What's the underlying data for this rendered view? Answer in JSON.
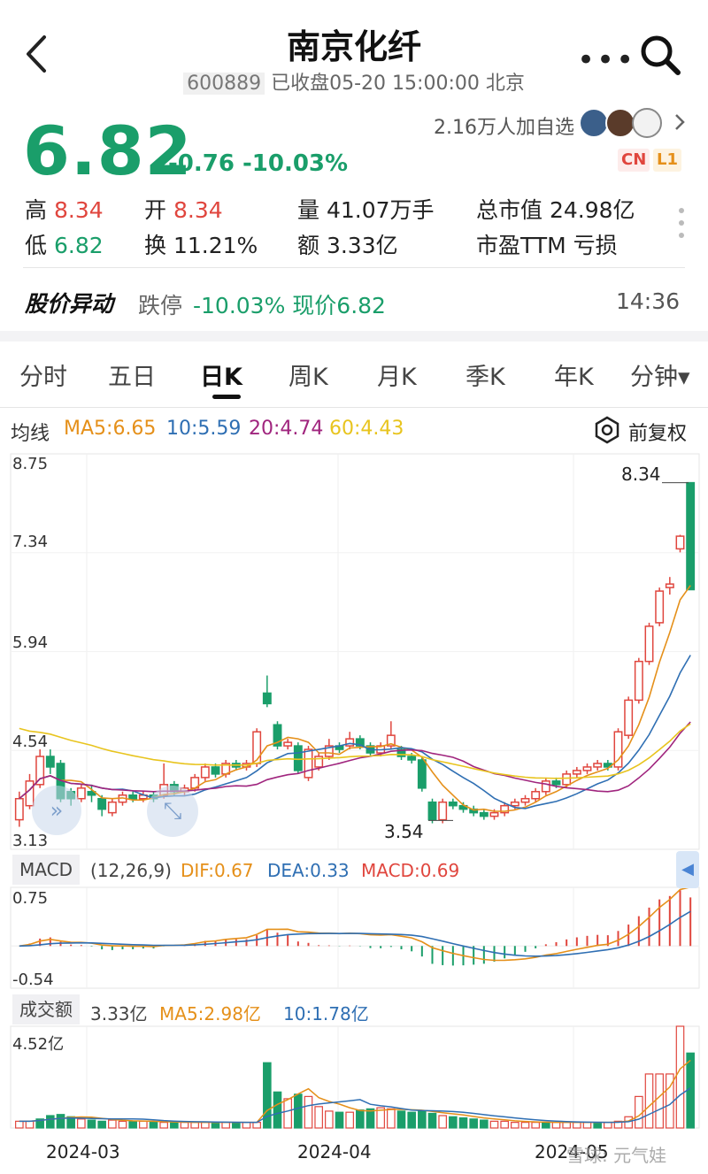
{
  "header": {
    "title": "南京化纤",
    "code": "600889",
    "status": "已收盘05-20 15:00:00 北京"
  },
  "quote": {
    "price": "6.82",
    "change": "-0.76 -10.03%",
    "watchers": "2.16万人加自选",
    "tag_cn": "CN",
    "tag_l1": "L1"
  },
  "stats": {
    "high_label": "高",
    "high": "8.34",
    "open_label": "开",
    "open": "8.34",
    "volume": "量 41.07万手",
    "mktcap": "总市值 24.98亿",
    "low_label": "低",
    "low": "6.82",
    "turnover_label": "换",
    "turnover": "11.21%",
    "amount": "额 3.33亿",
    "pe": "市盈TTM 亏损"
  },
  "alert": {
    "title": "股价异动",
    "type": "跌停",
    "text": "-10.03% 现价6.82",
    "time": "14:36"
  },
  "tabs": [
    "分时",
    "五日",
    "日K",
    "周K",
    "月K",
    "季K",
    "年K",
    "分钟▾"
  ],
  "active_tab": 2,
  "ma": {
    "label": "均线",
    "ma5": "MA5:6.65",
    "ma10": "10:5.59",
    "ma20": "20:4.74",
    "ma60": "60:4.43",
    "adjust": "前复权"
  },
  "colors": {
    "up": "#e0463e",
    "down": "#1a9e6a",
    "ma5": "#e5901a",
    "ma10": "#2f6fb3",
    "ma20": "#a0257e",
    "ma60": "#e8c41e"
  },
  "chart_data": {
    "type": "candlestick",
    "y_ticks": [
      "8.75",
      "7.34",
      "5.94",
      "4.54",
      "3.13"
    ],
    "ylim": [
      3.13,
      8.75
    ],
    "x_ticks": [
      "2024-03",
      "2024-04",
      "2024-05"
    ],
    "annotations": {
      "high": "8.34",
      "low": "3.54"
    },
    "candles": [
      {
        "o": 3.55,
        "c": 3.85,
        "h": 3.95,
        "l": 3.45
      },
      {
        "o": 3.75,
        "c": 4.1,
        "h": 4.2,
        "l": 3.7
      },
      {
        "o": 4.05,
        "c": 4.45,
        "h": 4.55,
        "l": 4.0
      },
      {
        "o": 4.45,
        "c": 4.3,
        "h": 4.55,
        "l": 4.2
      },
      {
        "o": 4.35,
        "c": 3.85,
        "h": 4.4,
        "l": 3.8
      },
      {
        "o": 3.95,
        "c": 3.85,
        "h": 4.0,
        "l": 3.75
      },
      {
        "o": 3.85,
        "c": 4.0,
        "h": 4.05,
        "l": 3.8
      },
      {
        "o": 3.95,
        "c": 3.9,
        "h": 4.05,
        "l": 3.8
      },
      {
        "o": 3.85,
        "c": 3.7,
        "h": 3.9,
        "l": 3.6
      },
      {
        "o": 3.65,
        "c": 3.8,
        "h": 3.85,
        "l": 3.6
      },
      {
        "o": 3.8,
        "c": 3.9,
        "h": 3.95,
        "l": 3.75
      },
      {
        "o": 3.9,
        "c": 3.85,
        "h": 3.95,
        "l": 3.8
      },
      {
        "o": 3.85,
        "c": 3.9,
        "h": 3.95,
        "l": 3.8
      },
      {
        "o": 3.9,
        "c": 3.85,
        "h": 3.95,
        "l": 3.8
      },
      {
        "o": 3.9,
        "c": 4.05,
        "h": 4.35,
        "l": 3.85
      },
      {
        "o": 4.05,
        "c": 3.95,
        "h": 4.1,
        "l": 3.9
      },
      {
        "o": 3.95,
        "c": 4.0,
        "h": 4.05,
        "l": 3.9
      },
      {
        "o": 4.0,
        "c": 4.15,
        "h": 4.2,
        "l": 3.95
      },
      {
        "o": 4.15,
        "c": 4.3,
        "h": 4.35,
        "l": 4.1
      },
      {
        "o": 4.3,
        "c": 4.2,
        "h": 4.35,
        "l": 4.15
      },
      {
        "o": 4.2,
        "c": 4.35,
        "h": 4.4,
        "l": 4.15
      },
      {
        "o": 4.35,
        "c": 4.3,
        "h": 4.4,
        "l": 4.25
      },
      {
        "o": 4.3,
        "c": 4.35,
        "h": 4.4,
        "l": 4.25
      },
      {
        "o": 4.35,
        "c": 4.8,
        "h": 4.85,
        "l": 4.3
      },
      {
        "o": 5.35,
        "c": 5.2,
        "h": 5.6,
        "l": 5.15
      },
      {
        "o": 4.9,
        "c": 4.6,
        "h": 4.95,
        "l": 4.55
      },
      {
        "o": 4.6,
        "c": 4.65,
        "h": 4.7,
        "l": 4.55
      },
      {
        "o": 4.6,
        "c": 4.25,
        "h": 4.65,
        "l": 4.2
      },
      {
        "o": 4.15,
        "c": 4.55,
        "h": 4.6,
        "l": 4.1
      },
      {
        "o": 4.3,
        "c": 4.45,
        "h": 4.5,
        "l": 4.25
      },
      {
        "o": 4.45,
        "c": 4.6,
        "h": 4.7,
        "l": 4.4
      },
      {
        "o": 4.6,
        "c": 4.55,
        "h": 4.65,
        "l": 4.5
      },
      {
        "o": 4.6,
        "c": 4.7,
        "h": 4.8,
        "l": 4.55
      },
      {
        "o": 4.7,
        "c": 4.6,
        "h": 4.75,
        "l": 4.55
      },
      {
        "o": 4.6,
        "c": 4.5,
        "h": 4.65,
        "l": 4.45
      },
      {
        "o": 4.5,
        "c": 4.6,
        "h": 4.65,
        "l": 4.45
      },
      {
        "o": 4.6,
        "c": 4.75,
        "h": 4.95,
        "l": 4.55
      },
      {
        "o": 4.55,
        "c": 4.45,
        "h": 4.6,
        "l": 4.4
      },
      {
        "o": 4.45,
        "c": 4.4,
        "h": 4.5,
        "l": 4.35
      },
      {
        "o": 4.4,
        "c": 4.0,
        "h": 4.45,
        "l": 3.95
      },
      {
        "o": 3.8,
        "c": 3.55,
        "h": 3.85,
        "l": 3.5
      },
      {
        "o": 3.55,
        "c": 3.8,
        "h": 3.85,
        "l": 3.5
      },
      {
        "o": 3.8,
        "c": 3.75,
        "h": 3.85,
        "l": 3.7
      },
      {
        "o": 3.75,
        "c": 3.7,
        "h": 3.8,
        "l": 3.65
      },
      {
        "o": 3.7,
        "c": 3.65,
        "h": 3.75,
        "l": 3.6
      },
      {
        "o": 3.65,
        "c": 3.6,
        "h": 3.7,
        "l": 3.55
      },
      {
        "o": 3.6,
        "c": 3.65,
        "h": 3.7,
        "l": 3.55
      },
      {
        "o": 3.65,
        "c": 3.75,
        "h": 3.8,
        "l": 3.6
      },
      {
        "o": 3.75,
        "c": 3.8,
        "h": 3.85,
        "l": 3.7
      },
      {
        "o": 3.8,
        "c": 3.85,
        "h": 3.9,
        "l": 3.75
      },
      {
        "o": 3.85,
        "c": 3.95,
        "h": 4.0,
        "l": 3.8
      },
      {
        "o": 3.95,
        "c": 4.1,
        "h": 4.15,
        "l": 3.9
      },
      {
        "o": 4.1,
        "c": 4.05,
        "h": 4.15,
        "l": 4.0
      },
      {
        "o": 4.05,
        "c": 4.2,
        "h": 4.25,
        "l": 4.0
      },
      {
        "o": 4.2,
        "c": 4.25,
        "h": 4.3,
        "l": 4.15
      },
      {
        "o": 4.25,
        "c": 4.3,
        "h": 4.35,
        "l": 4.2
      },
      {
        "o": 4.3,
        "c": 4.35,
        "h": 4.4,
        "l": 4.25
      },
      {
        "o": 4.35,
        "c": 4.3,
        "h": 4.4,
        "l": 4.25
      },
      {
        "o": 4.3,
        "c": 4.8,
        "h": 4.85,
        "l": 4.25
      },
      {
        "o": 4.75,
        "c": 5.25,
        "h": 5.3,
        "l": 4.7
      },
      {
        "o": 5.25,
        "c": 5.8,
        "h": 5.85,
        "l": 5.2
      },
      {
        "o": 5.8,
        "c": 6.3,
        "h": 6.35,
        "l": 5.75
      },
      {
        "o": 6.35,
        "c": 6.8,
        "h": 6.85,
        "l": 6.3
      },
      {
        "o": 6.85,
        "c": 6.9,
        "h": 7.0,
        "l": 6.75
      },
      {
        "o": 7.4,
        "c": 7.58,
        "h": 7.6,
        "l": 7.35
      },
      {
        "o": 8.34,
        "c": 6.82,
        "h": 8.34,
        "l": 6.82
      }
    ],
    "macd": {
      "label": "MACD",
      "params": "(12,26,9)",
      "dif": "DIF:0.67",
      "dea": "DEA:0.33",
      "macd": "MACD:0.69",
      "y_ticks": [
        "0.75",
        "-0.54"
      ],
      "ylim": [
        -0.54,
        0.75
      ]
    },
    "volume": {
      "label": "成交额",
      "amount": "3.33亿",
      "ma5": "MA5:2.98亿",
      "ma10": "10:1.78亿",
      "y_tick": "4.52亿",
      "ylim": [
        0,
        4.52
      ],
      "values": [
        0.3,
        0.3,
        0.4,
        0.55,
        0.6,
        0.5,
        0.4,
        0.35,
        0.3,
        0.35,
        0.3,
        0.3,
        0.3,
        0.25,
        0.25,
        0.25,
        0.25,
        0.25,
        0.25,
        0.25,
        0.25,
        0.25,
        0.25,
        0.25,
        2.9,
        1.6,
        1.3,
        1.5,
        1.4,
        0.95,
        0.75,
        0.7,
        0.7,
        0.8,
        0.85,
        0.9,
        0.85,
        0.75,
        0.7,
        0.75,
        0.65,
        0.55,
        0.5,
        0.45,
        0.4,
        0.35,
        0.3,
        0.3,
        0.25,
        0.25,
        0.25,
        0.25,
        0.25,
        0.25,
        0.25,
        0.25,
        0.25,
        0.25,
        0.3,
        0.5,
        1.4,
        2.4,
        2.4,
        2.4,
        4.52,
        3.33
      ],
      "ups": [
        1,
        1,
        0,
        0,
        0,
        0,
        1,
        0,
        0,
        1,
        1,
        0,
        1,
        0,
        1,
        0,
        1,
        1,
        1,
        0,
        1,
        0,
        1,
        1,
        0,
        0,
        1,
        0,
        1,
        1,
        1,
        0,
        1,
        0,
        0,
        1,
        1,
        0,
        0,
        0,
        0,
        1,
        0,
        0,
        0,
        0,
        1,
        1,
        1,
        1,
        1,
        0,
        1,
        1,
        1,
        1,
        0,
        1,
        1,
        1,
        1,
        1,
        1,
        1,
        1,
        0
      ]
    }
  },
  "watermark": "雪球: 元气娃"
}
